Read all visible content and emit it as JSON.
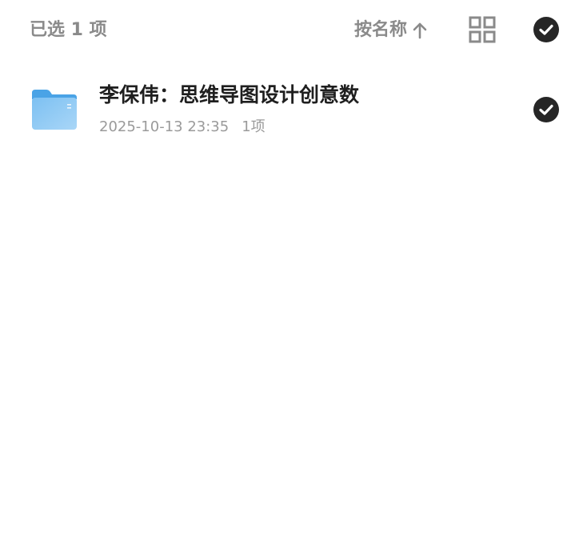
{
  "header": {
    "selected_count": "已选 1 项",
    "sort_label": "按名称",
    "sort_direction_icon": "arrow-up-icon",
    "view_toggle_icon": "grid-view-icon",
    "select_all_icon": "check-circle-icon"
  },
  "files": [
    {
      "icon": "folder-icon",
      "name": "李保伟：思维导图设计创意数",
      "date": "2025-10-13 23:35",
      "count": "1项",
      "selected": true
    }
  ],
  "colors": {
    "header_text": "#8a8a8a",
    "file_name": "#1f1f1f",
    "file_meta": "#9a9a9a",
    "check_fill": "#262626",
    "folder_blue": "#5aaeea",
    "folder_light": "#9fd0f5"
  }
}
